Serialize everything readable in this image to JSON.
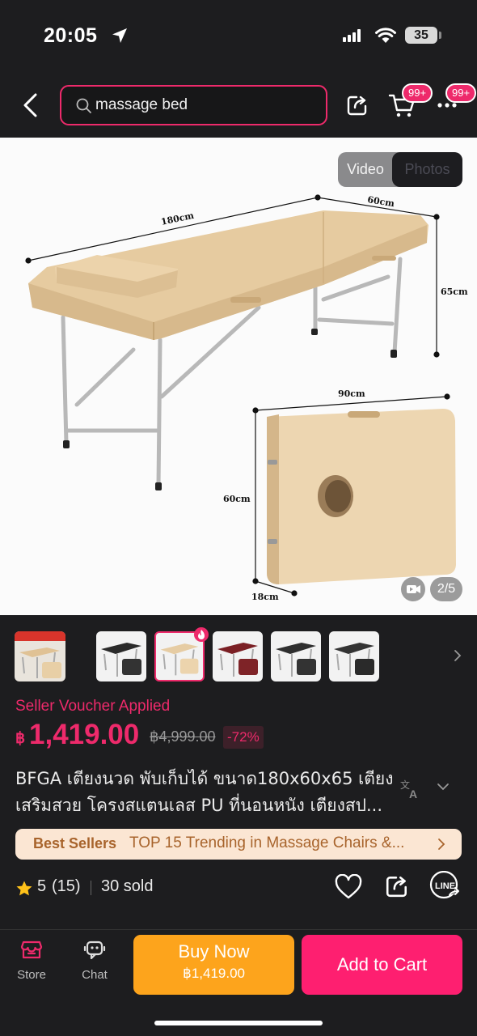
{
  "status_bar": {
    "time": "20:05",
    "battery": "35"
  },
  "search": {
    "query": "massage bed"
  },
  "header": {
    "cart_badge": "99+",
    "more_badge": "99+"
  },
  "gallery": {
    "toggle": {
      "video": "Video",
      "photos": "Photos",
      "selected": "photos"
    },
    "counter": "2/5",
    "dimension_labels": {
      "length": "180cm",
      "width": "60cm",
      "height": "65cm",
      "folded_width": "90cm",
      "folded_height": "60cm",
      "folded_depth": "18cm"
    },
    "bed_color": "#e9cfa5"
  },
  "thumbnails": {
    "selected_index": 1,
    "items": [
      {
        "name": "thumb-black-bed",
        "color": "#2a2a2a"
      },
      {
        "name": "thumb-beige-bed",
        "color": "#e6cca3"
      },
      {
        "name": "thumb-red-bed",
        "color": "#7a1f24"
      },
      {
        "name": "thumb-black-bed-2",
        "color": "#2e2e2e"
      },
      {
        "name": "thumb-black-bed-3",
        "color": "#333333"
      }
    ]
  },
  "price": {
    "voucher": "Seller Voucher Applied",
    "currency": "฿",
    "current": "1,419.00",
    "original": "฿4,999.00",
    "discount": "-72%"
  },
  "product": {
    "title_line1": "BFGA เตียงนวด พับเก็บได้ ขนาด180x60x65 เตียง",
    "title_line2": "เสริมสวย โครงสแตนเลส PU ที่นอนหนัง เตียงสป..."
  },
  "banner": {
    "label": "Best Sellers",
    "text": "TOP 15 Trending in Massage Chairs &..."
  },
  "rating": {
    "score": "5",
    "count": "(15)",
    "sold": "30 sold"
  },
  "bottom_bar": {
    "store": "Store",
    "chat": "Chat",
    "buy_now": "Buy Now",
    "buy_now_price": "฿1,419.00",
    "add_to_cart": "Add to Cart"
  },
  "colors": {
    "accent": "#ee2a6b",
    "buy_now": "#fda41c",
    "add_to_cart": "#fe1f70",
    "background": "#1d1d1f"
  }
}
